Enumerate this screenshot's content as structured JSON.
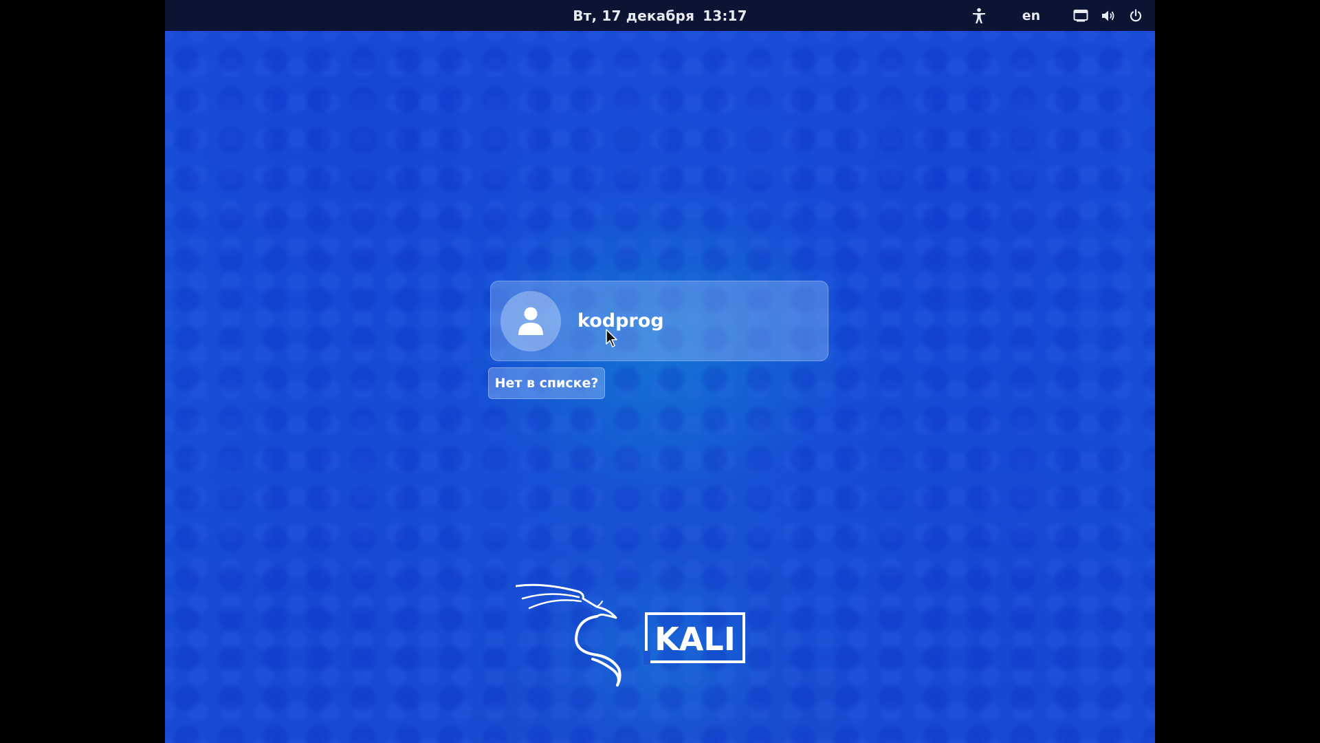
{
  "topbar": {
    "date": "Вт, 17 декабря",
    "time": "13:17",
    "language": "en",
    "icons": [
      "accessibility-icon",
      "network-icon",
      "volume-icon",
      "power-icon"
    ]
  },
  "login": {
    "username": "kodprog",
    "not_listed_label": "Нет в списке?"
  },
  "branding": {
    "logo_text": "KALI"
  },
  "colors": {
    "topbar_bg": "#0b1433",
    "desktop_bg": "#1a4fd8",
    "text": "#ffffff"
  }
}
